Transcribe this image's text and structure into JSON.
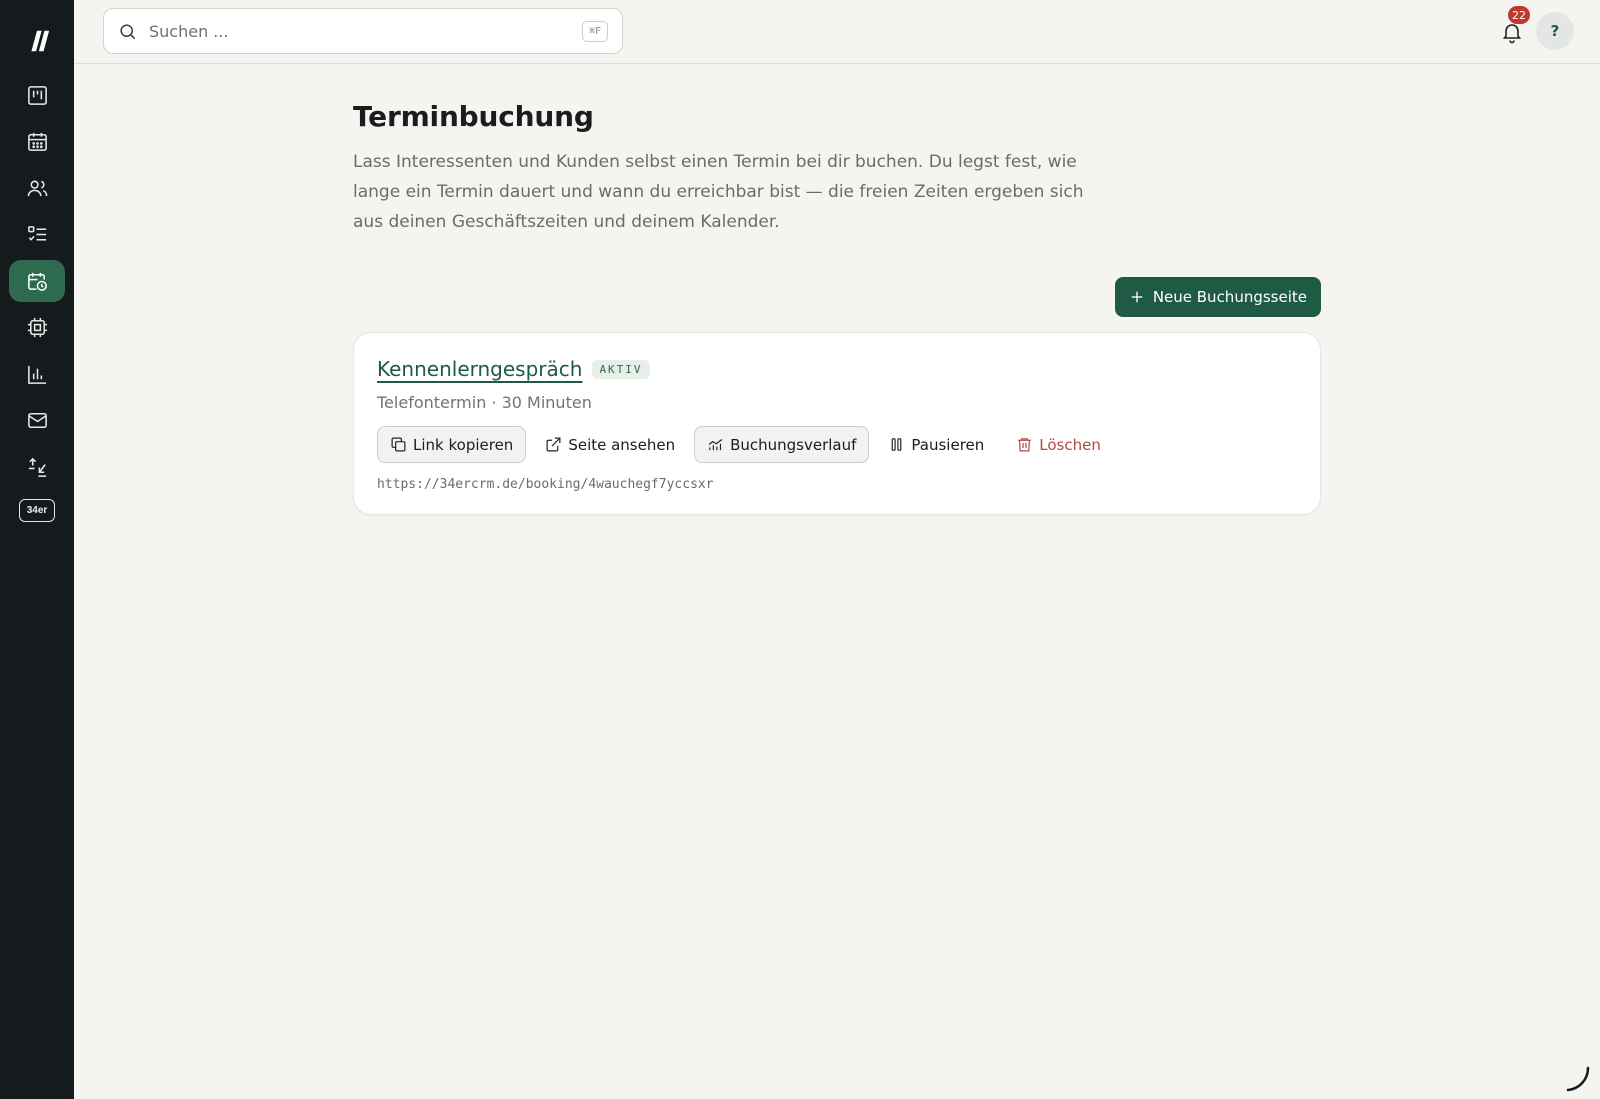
{
  "sidebar": {
    "logo_icon": "slash-logo-icon",
    "items": [
      {
        "icon": "kanban-board-icon",
        "active": false
      },
      {
        "icon": "calendar-icon",
        "active": false
      },
      {
        "icon": "users-icon",
        "active": false
      },
      {
        "icon": "task-list-icon",
        "active": false
      },
      {
        "icon": "calendar-clock-icon",
        "active": true
      },
      {
        "icon": "chip-icon",
        "active": false
      },
      {
        "icon": "bar-chart-icon",
        "active": false
      },
      {
        "icon": "mail-icon",
        "active": false
      },
      {
        "icon": "import-export-icon",
        "active": false
      }
    ],
    "brand_label": "34er"
  },
  "topbar": {
    "search_placeholder": "Suchen ...",
    "search_shortcut": "⌘F",
    "notification_count": "22",
    "help_label": "?"
  },
  "main": {
    "title": "Terminbuchung",
    "description": "Lass Interessenten und Kunden selbst einen Termin bei dir buchen. Du legst fest, wie lange ein Termin dauert und wann du erreichbar bist — die freien Zeiten ergeben sich aus deinen Geschäftszeiten und deinem Kalender.",
    "new_button_label": "Neue Buchungsseite"
  },
  "booking_pages": [
    {
      "title": "Kennenlerngespräch",
      "status": "AKTIV",
      "subtitle": "Telefontermin · 30 Minuten",
      "actions": {
        "copy_link": "Link kopieren",
        "view_page": "Seite ansehen",
        "history": "Buchungsverlauf",
        "pause": "Pausieren",
        "delete": "Löschen"
      },
      "url": "https://34ercrm.de/booking/4wauchegf7yccsxr"
    }
  ],
  "colors": {
    "sidebar_bg": "#151b1d",
    "accent": "#1f5a44",
    "active_nav": "#2d6a4f",
    "danger": "#b5483a",
    "page_bg": "#f5f4f1"
  }
}
